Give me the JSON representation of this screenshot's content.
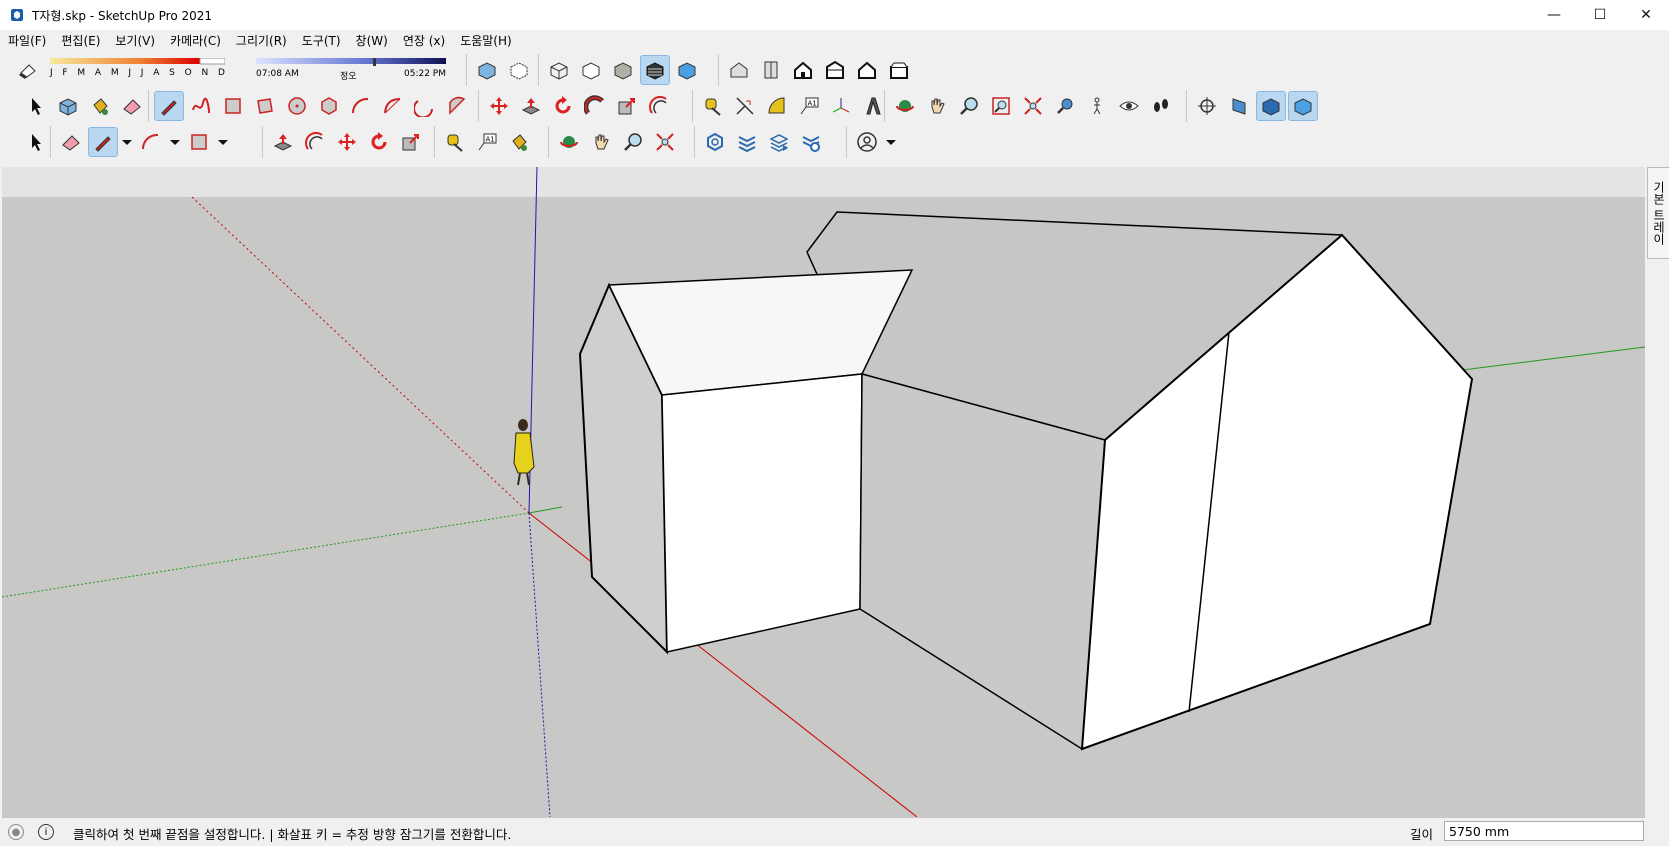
{
  "window": {
    "title": "T자형.skp - SketchUp Pro 2021",
    "minimize_glyph": "—",
    "maximize_glyph": "☐",
    "close_glyph": "✕"
  },
  "menu": [
    "파일(F)",
    "편집(E)",
    "보기(V)",
    "카메라(C)",
    "그리기(R)",
    "도구(T)",
    "창(W)",
    "연장 (x)",
    "도움말(H)"
  ],
  "shadows": {
    "months": [
      "J",
      "F",
      "M",
      "A",
      "M",
      "J",
      "J",
      "A",
      "S",
      "O",
      "N",
      "D"
    ],
    "time_start": "07:08 AM",
    "time_mid": "정오",
    "time_end": "05:22 PM"
  },
  "tray": {
    "label": "기본 트레이"
  },
  "status": {
    "message": "클릭하여 첫 번째 끝점을 설정합니다. | 화살표 키 = 추정 방향 잠그기를 전환합니다.",
    "vcb_label": "길이",
    "vcb_value": "5750 mm"
  },
  "colors": {
    "canvas_bg": "#c8c8c6",
    "axis_red": "#cc0000",
    "axis_green": "#1f9a1f",
    "axis_blue": "#1a1aa8",
    "accent_active": "#b9d7f0"
  }
}
